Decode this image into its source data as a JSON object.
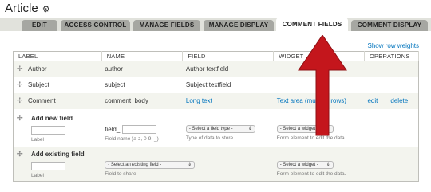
{
  "page": {
    "title": "Article",
    "gear_icon": "gear-icon"
  },
  "tabs": [
    {
      "label": "EDIT",
      "active": false
    },
    {
      "label": "ACCESS CONTROL",
      "active": false
    },
    {
      "label": "MANAGE FIELDS",
      "active": false
    },
    {
      "label": "MANAGE DISPLAY",
      "active": false
    },
    {
      "label": "COMMENT FIELDS",
      "active": true
    },
    {
      "label": "COMMENT DISPLAY",
      "active": false
    }
  ],
  "row_weights_link": "Show row weights",
  "table": {
    "headers": [
      "LABEL",
      "NAME",
      "FIELD",
      "WIDGET",
      "OPERATIONS"
    ],
    "rows": [
      {
        "label": "Author",
        "name": "author",
        "field": "Author textfield",
        "widget": "",
        "edit": "",
        "delete": ""
      },
      {
        "label": "Subject",
        "name": "subject",
        "field": "Subject textfield",
        "widget": "",
        "edit": "",
        "delete": ""
      },
      {
        "label": "Comment",
        "name": "comment_body",
        "field": "Long text",
        "widget": "Text area (multiple rows)",
        "edit": "edit",
        "delete": "delete"
      }
    ],
    "add_new": {
      "title": "Add new field",
      "label_desc": "Label",
      "name_prefix": "field_",
      "name_desc": "Field name (a-z, 0-9, _)",
      "type_select": "- Select a field type -",
      "type_desc": "Type of data to store.",
      "widget_select": "- Select a widget -",
      "widget_desc": "Form element to edit the data."
    },
    "add_existing": {
      "title": "Add existing field",
      "label_desc": "Label",
      "field_select": "- Select an existing field -",
      "field_desc": "Field to share",
      "widget_select": "- Select a widget -",
      "widget_desc": "Form element to edit the data."
    }
  },
  "annotation": {
    "arrow_color": "#c4161c"
  }
}
